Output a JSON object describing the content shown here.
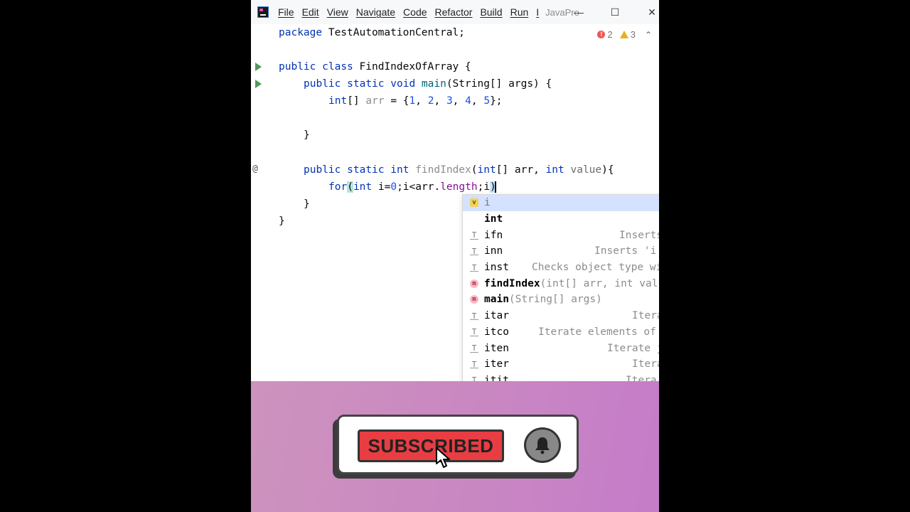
{
  "window": {
    "menu": [
      "File",
      "Edit",
      "View",
      "Navigate",
      "Code",
      "Refactor",
      "Build",
      "Run",
      "I"
    ],
    "project": "JavaPro",
    "controls": {
      "minimize": "—",
      "maximize": "☐",
      "close": "✕"
    }
  },
  "inspections": {
    "errors": "2",
    "warnings": "3"
  },
  "code": {
    "l1": {
      "kw": "package",
      "rest": " TestAutomationCentral;"
    },
    "l3": {
      "kw1": "public",
      "kw2": "class",
      "rest": " FindIndexOfArray {"
    },
    "l4": {
      "kw1": "public",
      "kw2": "static",
      "kw3": "void",
      "fn": "main",
      "rest": "(String[] args) {"
    },
    "l5": {
      "type": "int",
      "br": "[] ",
      "var": "arr",
      "eq": " = {",
      "n1": "1",
      "n2": "2",
      "n3": "3",
      "n4": "4",
      "n5": "5",
      "end": "};"
    },
    "l7": "}",
    "l9": {
      "kw1": "public",
      "kw2": "static",
      "kw3": "int",
      "fn": "findIndex",
      "p1": "(",
      "t1": "int",
      "p2": "[] arr, ",
      "t2": "int",
      "param": "value",
      "p3": "){"
    },
    "l10": {
      "kw": "for",
      "paren": "(",
      "t": "int",
      "a": " i=",
      "zero": "0",
      "b": ";i<arr.",
      "field": "length",
      "c": ";",
      "typed": "i",
      "close": ")"
    },
    "l11": "}",
    "l12": "}"
  },
  "completion": [
    {
      "icon": "v",
      "kind": "var",
      "label": "i",
      "sig": "",
      "hint": ""
    },
    {
      "icon": "",
      "kind": "none",
      "label": "int",
      "sig": "",
      "hint": ""
    },
    {
      "icon": "T",
      "kind": "tmpl",
      "label": "ifn",
      "sig": "",
      "hint": "Inserts"
    },
    {
      "icon": "T",
      "kind": "tmpl",
      "label": "inn",
      "sig": "",
      "hint": "Inserts 'i"
    },
    {
      "icon": "T",
      "kind": "tmpl",
      "label": "inst",
      "sig": "",
      "hint": "Checks object type wi"
    },
    {
      "icon": "m",
      "kind": "method",
      "label": "findIndex",
      "sig": "(int[] arr, int val",
      "hint": ""
    },
    {
      "icon": "m",
      "kind": "method",
      "label": "main",
      "sig": "(String[] args)",
      "hint": ""
    },
    {
      "icon": "T",
      "kind": "tmpl",
      "label": "itar",
      "sig": "",
      "hint": "Itera"
    },
    {
      "icon": "T",
      "kind": "tmpl",
      "label": "itco",
      "sig": "",
      "hint": "Iterate elements of"
    },
    {
      "icon": "T",
      "kind": "tmpl",
      "label": "iten",
      "sig": "",
      "hint": "Iterate j"
    },
    {
      "icon": "T",
      "kind": "tmpl",
      "label": "iter",
      "sig": "",
      "hint": "Itera"
    },
    {
      "icon": "T",
      "kind": "tmpl",
      "label": "itit",
      "sig": "",
      "hint": "Itera"
    }
  ],
  "promo": {
    "subscribe": "SUBSCRIBED"
  },
  "colors": {
    "accent": "#e83d42",
    "background": "#c987c2"
  }
}
